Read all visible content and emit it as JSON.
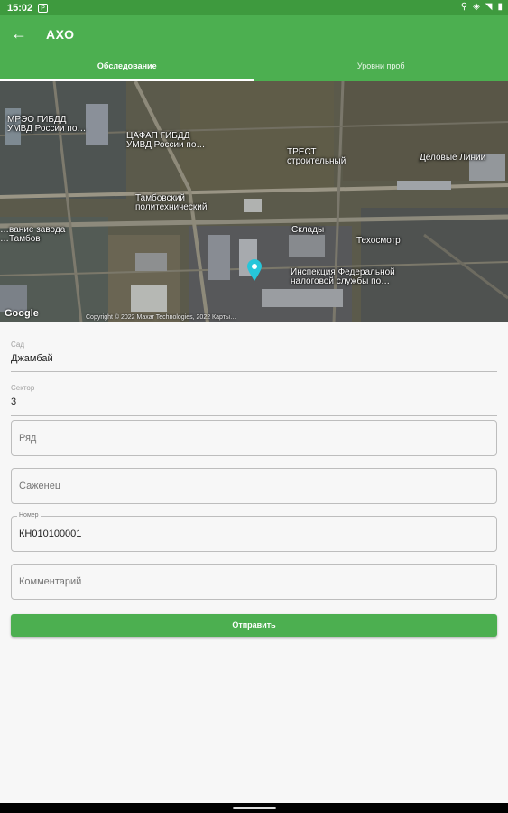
{
  "status_bar": {
    "time": "15:02",
    "notif_badge": "P"
  },
  "app_bar": {
    "title": "АХО",
    "back_icon": "arrow-left-icon"
  },
  "tabs": [
    {
      "label": "Обследование",
      "active": true
    },
    {
      "label": "Уровни проб",
      "active": false
    }
  ],
  "map": {
    "labels": [
      "МРЭО ГИБДД\nУМВД России по…",
      "ЦАФАП ГИБДД\nУМВД России по…",
      "ТРЕСТ\nстроительный",
      "Деловые Линии",
      "Тамбовский\nполитехнический",
      "Склады",
      "Техосмотр",
      "Инспекция Федеральной\nналоговой службы по…",
      "…вание завода\n…Тамбов"
    ],
    "google_logo": "Google",
    "copyright": "Copyright © 2022 Maxar Technologies, 2022 Карты…"
  },
  "form": {
    "garden": {
      "label": "Сад",
      "value": "Джамбай"
    },
    "sector": {
      "label": "Сектор",
      "value": "3"
    },
    "row": {
      "placeholder": "Ряд"
    },
    "sapling": {
      "placeholder": "Саженец"
    },
    "number": {
      "label": "Номер",
      "value": "КН010100001"
    },
    "comment": {
      "placeholder": "Комментарий"
    },
    "submit_label": "Отправить"
  },
  "colors": {
    "primary": "#4caf50",
    "status_bar": "#3e9a3e",
    "marker": "#26c6da"
  }
}
